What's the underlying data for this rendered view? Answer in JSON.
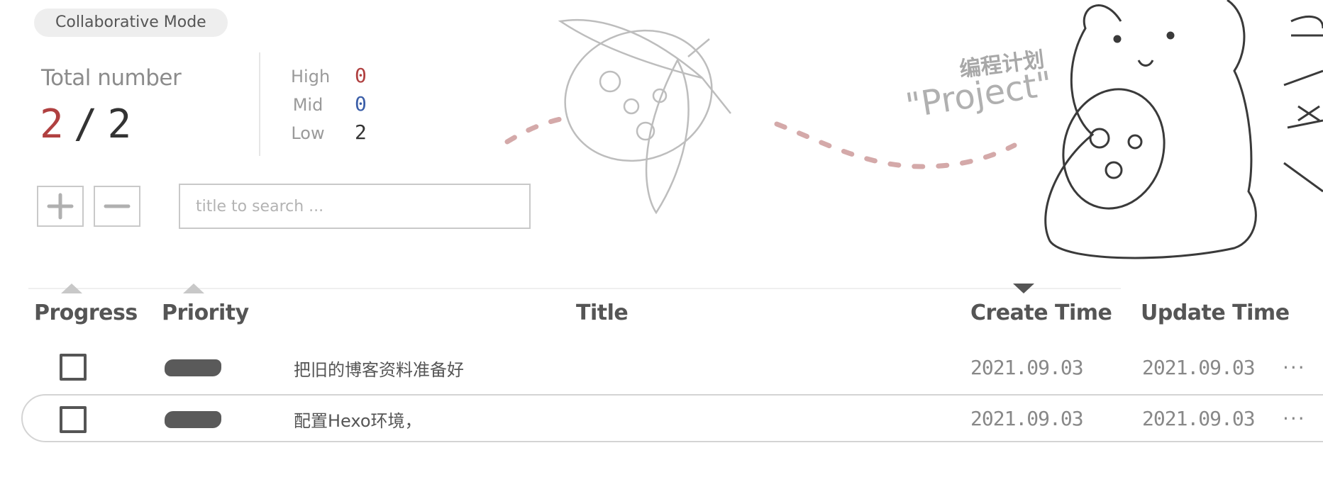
{
  "header": {
    "mode_label": "Collaborative Mode"
  },
  "stats": {
    "total_label": "Total number",
    "completed": "2",
    "separator": "/",
    "total": "2",
    "priorities": [
      {
        "label": "High",
        "count": "0",
        "color": "#b04040"
      },
      {
        "label": "Mid",
        "count": "0",
        "color": "#3b5ea8"
      },
      {
        "label": "Low",
        "count": "2",
        "color": "#333333"
      }
    ]
  },
  "toolbar": {
    "add_icon": "plus-icon",
    "remove_icon": "minus-icon",
    "search_placeholder": "title to search ..."
  },
  "decor": {
    "project_cn": "编程计划",
    "project_en": "\"Project\""
  },
  "table": {
    "columns": {
      "progress": "Progress",
      "priority": "Priority",
      "title": "Title",
      "create_time": "Create Time",
      "update_time": "Update Time"
    },
    "rows": [
      {
        "title": "把旧的博客资料准备好",
        "create_time": "2021.09.03",
        "update_time": "2021.09.03",
        "more": "···"
      },
      {
        "title": "配置Hexo环境，",
        "create_time": "2021.09.03",
        "update_time": "2021.09.03",
        "more": "···"
      }
    ]
  }
}
